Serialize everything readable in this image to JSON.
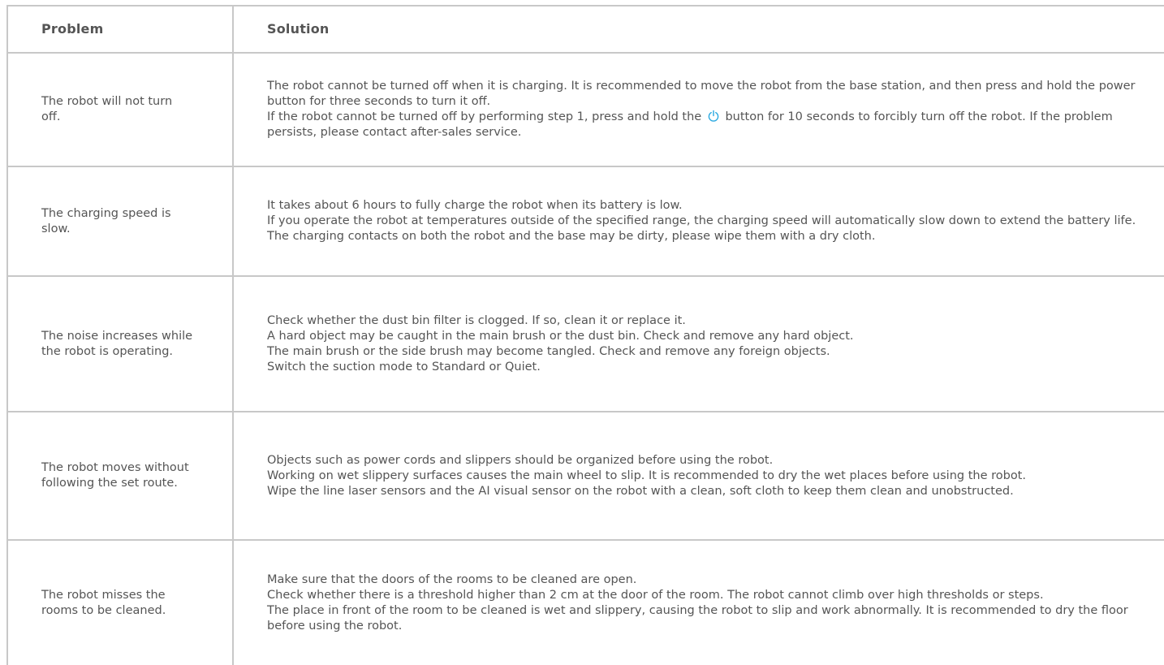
{
  "header": {
    "problem": "Problem",
    "solution": "Solution"
  },
  "rows": [
    {
      "problem": "The robot will not turn off.",
      "solution": [
        {
          "text": "The robot cannot be turned off when it is charging. It is recommended to move the robot from the base station, and then press and hold the power button for three seconds to turn it off."
        },
        {
          "before": "If the robot cannot be turned off by performing step 1, press and hold the",
          "icon": "power-icon",
          "after": "button for 10 seconds to forcibly turn off the robot. If the problem persists, please contact after-sales service."
        }
      ]
    },
    {
      "problem": "The charging speed is slow.",
      "solution": [
        {
          "text": "It takes about 6 hours to fully charge the robot when its battery is low."
        },
        {
          "text": "If you operate the robot at temperatures outside of the specified range, the charging speed will automatically slow down to extend the battery life."
        },
        {
          "text": "The charging contacts on both the robot and the base may be dirty, please wipe them with a dry cloth."
        }
      ]
    },
    {
      "problem": "The noise increases while the robot is operating.",
      "solution": [
        {
          "text": "Check whether the dust bin filter is clogged. If so, clean it or replace it."
        },
        {
          "text": "A hard object may be caught in the main brush or the dust bin. Check and remove any hard object."
        },
        {
          "text": "The main brush or the side brush may become tangled. Check and remove any foreign objects."
        },
        {
          "text": "Switch the suction mode to Standard or Quiet."
        }
      ]
    },
    {
      "problem": "The robot moves without following the set route.",
      "solution": [
        {
          "text": "Objects such as power cords and slippers should be organized before using the robot."
        },
        {
          "text": "Working on wet slippery surfaces causes the main wheel to slip. It is recommended to dry the wet places before using the robot."
        },
        {
          "text": "Wipe the line laser sensors and the AI visual sensor on the robot with a clean, soft cloth to keep them clean and unobstructed."
        }
      ]
    },
    {
      "problem": "The robot misses the rooms to be cleaned.",
      "solution": [
        {
          "text": "Make sure that the doors of the rooms to be cleaned are open."
        },
        {
          "text": "Check whether there is a threshold higher than 2 cm at the door of the room. The robot cannot climb over high thresholds or steps."
        },
        {
          "text": "The place in front of the room to be cleaned is wet and slippery, causing the robot to slip and work abnormally. It is recommended to dry the floor before using the robot."
        }
      ]
    }
  ],
  "colors": {
    "border": "#c8c8c8",
    "text": "#555555",
    "icon": "#29a9e0"
  }
}
